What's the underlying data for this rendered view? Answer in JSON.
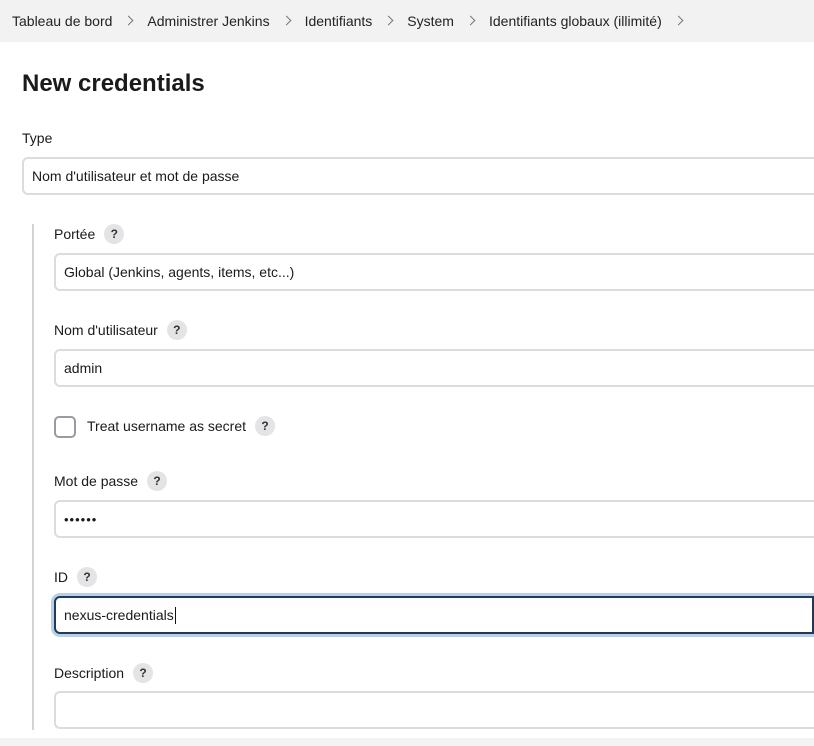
{
  "breadcrumb": {
    "items": [
      "Tableau de bord",
      "Administrer Jenkins",
      "Identifiants",
      "System",
      "Identifiants globaux (illimité)"
    ]
  },
  "page": {
    "title": "New credentials"
  },
  "form": {
    "type": {
      "label": "Type",
      "value": "Nom d'utilisateur et mot de passe"
    },
    "scope": {
      "label": "Portée",
      "help": "?",
      "value": "Global (Jenkins, agents, items, etc...)"
    },
    "username": {
      "label": "Nom d'utilisateur",
      "help": "?",
      "value": "admin"
    },
    "secret_username": {
      "label": "Treat username as secret",
      "help": "?",
      "checked": false
    },
    "password": {
      "label": "Mot de passe",
      "help": "?",
      "value": "••••••"
    },
    "id": {
      "label": "ID",
      "help": "?",
      "value": "nexus-credentials"
    },
    "description": {
      "label": "Description",
      "help": "?",
      "value": ""
    }
  }
}
